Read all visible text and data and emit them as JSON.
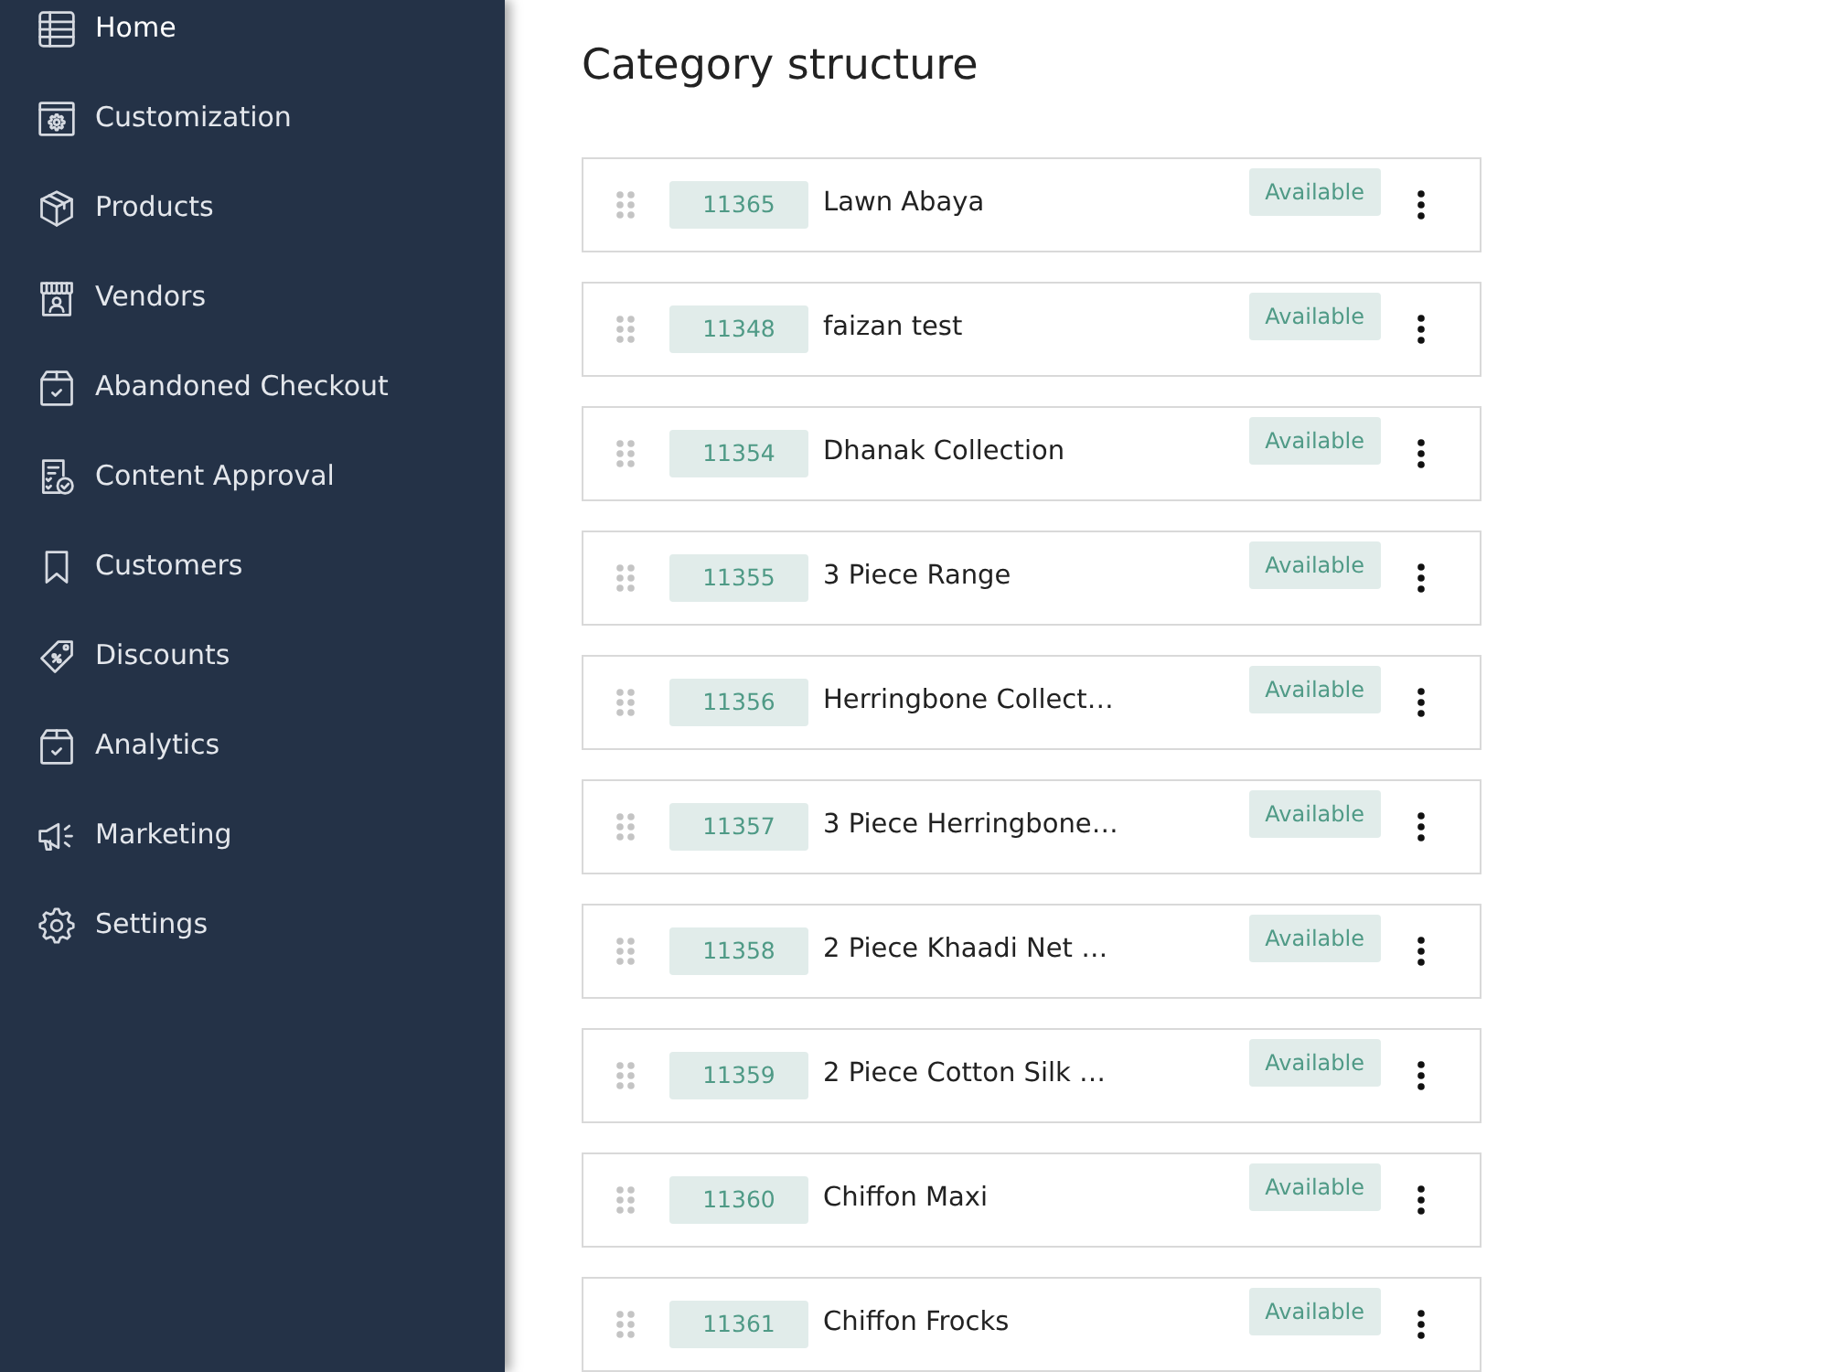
{
  "sidebar": {
    "items": [
      {
        "label": "Home"
      },
      {
        "label": "Customization"
      },
      {
        "label": "Products"
      },
      {
        "label": "Vendors"
      },
      {
        "label": "Abandoned Checkout"
      },
      {
        "label": "Content Approval"
      },
      {
        "label": "Customers"
      },
      {
        "label": "Discounts"
      },
      {
        "label": "Analytics"
      },
      {
        "label": "Marketing"
      },
      {
        "label": "Settings"
      }
    ]
  },
  "page": {
    "title": "Category structure"
  },
  "categories": [
    {
      "id": "11365",
      "name": "Lawn Abaya",
      "status": "Available"
    },
    {
      "id": "11348",
      "name": "faizan test",
      "status": "Available"
    },
    {
      "id": "11354",
      "name": "Dhanak Collection",
      "status": "Available"
    },
    {
      "id": "11355",
      "name": "3 Piece Range",
      "status": "Available"
    },
    {
      "id": "11356",
      "name": "Herringbone Collect…",
      "status": "Available"
    },
    {
      "id": "11357",
      "name": "3 Piece Herringbone…",
      "status": "Available"
    },
    {
      "id": "11358",
      "name": "2 Piece Khaadi Net …",
      "status": "Available"
    },
    {
      "id": "11359",
      "name": "2 Piece Cotton Silk …",
      "status": "Available"
    },
    {
      "id": "11360",
      "name": "Chiffon Maxi",
      "status": "Available"
    },
    {
      "id": "11361",
      "name": "Chiffon Frocks",
      "status": "Available"
    }
  ]
}
